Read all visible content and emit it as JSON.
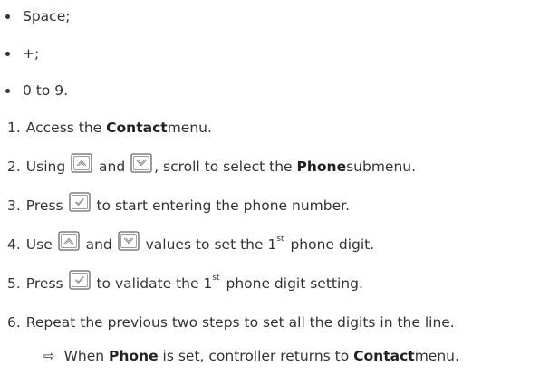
{
  "bullets": [
    {
      "text": "Space;"
    },
    {
      "text": "+;"
    },
    {
      "text": "0 to 9."
    }
  ],
  "steps": [
    {
      "num": "1.",
      "pre": "Access the ",
      "bold": "Contact",
      "post": " menu."
    },
    {
      "num": "2.",
      "pre": "Using ",
      "and": " and ",
      "mid": ", scroll to select the ",
      "bold": "Phone",
      "post": " submenu."
    },
    {
      "num": "3.",
      "pre": "Press ",
      "post": " to start entering the phone number."
    },
    {
      "num": "4.",
      "pre": "Use ",
      "and": " and ",
      "mid": " values to set the 1",
      "sup": "st",
      "post": " phone digit."
    },
    {
      "num": "5.",
      "pre": "Press ",
      "mid": " to validate the 1",
      "sup": "st",
      "post": " phone digit setting."
    },
    {
      "num": "6.",
      "text": "Repeat the previous two steps to set all the digits in the line."
    }
  ],
  "result": {
    "symbol": "⇨",
    "pre": "When ",
    "bold1": "Phone",
    "mid": " is set, controller returns to ",
    "bold2": "Contact",
    "post": " menu."
  },
  "icons": {
    "up": "up-arrow-key-icon",
    "down": "down-arrow-key-icon",
    "ok": "check-key-icon"
  }
}
